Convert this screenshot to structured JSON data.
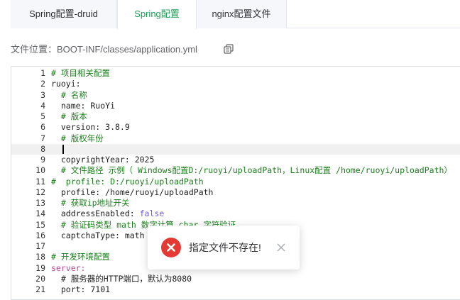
{
  "tabs": [
    {
      "label": "Spring配置-druid",
      "active": false
    },
    {
      "label": "Spring配置",
      "active": true
    },
    {
      "label": "nginx配置文件",
      "active": false
    }
  ],
  "file_location_label": "文件位置：BOOT-INF/classes/application.yml",
  "colors": {
    "accent": "#1f9d55",
    "comment": "#1a7f1a",
    "key_plain": "#222222",
    "keyword": "#b24a9b",
    "boolean": "#6b5bd6",
    "error": "#e53935"
  },
  "editor": {
    "active_line": 8,
    "lines": [
      {
        "n": "1",
        "text": "# 项目相关配置",
        "kind": "comment"
      },
      {
        "n": "2",
        "text": "ruoyi:",
        "kind": "plain"
      },
      {
        "n": "3",
        "text": "  # 名称",
        "kind": "comment"
      },
      {
        "n": "4",
        "text": "  name: RuoYi",
        "kind": "plain"
      },
      {
        "n": "5",
        "text": "  # 版本",
        "kind": "comment"
      },
      {
        "n": "6",
        "text": "  version: 3.8.9",
        "kind": "plain"
      },
      {
        "n": "7",
        "text": "  # 版权年份",
        "kind": "comment"
      },
      {
        "n": "8",
        "text": "  ",
        "kind": "plain"
      },
      {
        "n": "9",
        "text": "  copyrightYear: 2025",
        "kind": "plain"
      },
      {
        "n": "10",
        "text": "  # 文件路径 示例（ Windows配置D:/ruoyi/uploadPath，Linux配置 /home/ruoyi/uploadPath）",
        "kind": "comment"
      },
      {
        "n": "11",
        "text": "#  profile: D:/ruoyi/uploadPath",
        "kind": "comment"
      },
      {
        "n": "12",
        "text": "  profile: /home/ruoyi/uploadPath",
        "kind": "plain"
      },
      {
        "n": "13",
        "text": "  # 获取ip地址开关",
        "kind": "comment"
      },
      {
        "n": "14",
        "text": "  addressEnabled: ",
        "value": "false",
        "kind": "bool"
      },
      {
        "n": "15",
        "text": "  # 验证码类型 math 数字计算 char 字符验证",
        "kind": "comment"
      },
      {
        "n": "16",
        "text": "  captchaType: math",
        "kind": "plain"
      },
      {
        "n": "17",
        "text": "",
        "kind": "plain"
      },
      {
        "n": "18",
        "text": "# 开发环境配置",
        "kind": "comment"
      },
      {
        "n": "19",
        "text": "server:",
        "kind": "keyword"
      },
      {
        "n": "20",
        "text": "  # 服务器的HTTP端口，默认为8080",
        "kind": "plain"
      },
      {
        "n": "21",
        "text": "  port: 7101",
        "kind": "plain"
      }
    ]
  },
  "toast": {
    "message": "指定文件不存在!",
    "icon": "error-circle-icon",
    "close_icon": "close-icon"
  }
}
